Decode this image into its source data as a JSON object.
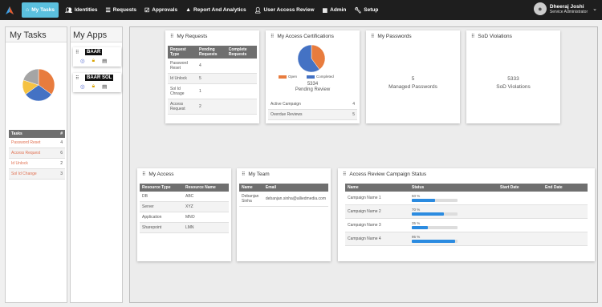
{
  "nav": {
    "items": [
      {
        "label": "My Tasks",
        "icon": "home-icon"
      },
      {
        "label": "Identities",
        "icon": "users-icon"
      },
      {
        "label": "Requests",
        "icon": "list-icon"
      },
      {
        "label": "Approvals",
        "icon": "check-icon"
      },
      {
        "label": "Report And Analytics",
        "icon": "chart-icon"
      },
      {
        "label": "User Access Review",
        "icon": "user-check-icon"
      },
      {
        "label": "Admin",
        "icon": "admin-icon"
      },
      {
        "label": "Setup",
        "icon": "wrench-icon"
      }
    ],
    "user_name": "Dheeraj Joshi",
    "user_role": "Service Administrator"
  },
  "my_tasks": {
    "title": "My Tasks",
    "pie": [
      {
        "value": 35,
        "color": "#e87c3e"
      },
      {
        "value": 30,
        "color": "#4472c4"
      },
      {
        "value": 15,
        "color": "#f5c242"
      },
      {
        "value": 20,
        "color": "#a5a5a5"
      }
    ],
    "table_headers": [
      "Tasks",
      "#"
    ],
    "rows": [
      {
        "name": "Password Reset",
        "count": "4"
      },
      {
        "name": "Access Request",
        "count": "6"
      },
      {
        "name": "Id Unlock",
        "count": "2"
      },
      {
        "name": "Sol Id Change",
        "count": "3"
      }
    ]
  },
  "my_apps": {
    "title": "My Apps",
    "apps": [
      {
        "name": "BAAR"
      },
      {
        "name": "BAAR SOL"
      }
    ]
  },
  "my_requests": {
    "title": "My Requests",
    "headers": [
      "Request Type",
      "Pending Requests",
      "Complete Requests"
    ],
    "rows": [
      {
        "type": "Password Reset",
        "pending": "4",
        "complete": ""
      },
      {
        "type": "Id Unlock",
        "pending": "5",
        "complete": ""
      },
      {
        "type": "Sol Id Chnage",
        "pending": "1",
        "complete": ""
      },
      {
        "type": "Access Request",
        "pending": "2",
        "complete": ""
      }
    ]
  },
  "certifications": {
    "title": "My Access Certifications",
    "legend": [
      "Open",
      "Completed"
    ],
    "legend_colors": [
      "#e87c3e",
      "#4472c4"
    ],
    "pie": [
      {
        "value": 40,
        "color": "#e87c3e"
      },
      {
        "value": 60,
        "color": "#4472c4"
      }
    ],
    "count": "5334",
    "count_label": "Pending Review",
    "rows": [
      {
        "name": "Active Campaign",
        "count": "4"
      },
      {
        "name": "Overdue Reviews",
        "count": "5"
      }
    ]
  },
  "passwords": {
    "title": "My Passwords",
    "count": "5",
    "label": "Managed Passwords"
  },
  "sod": {
    "title": "SoD Violations",
    "count": "5333",
    "label": "SoD Violations"
  },
  "my_access": {
    "title": "My Access",
    "headers": [
      "Resource Type",
      "Resource Name"
    ],
    "rows": [
      {
        "type": "DB",
        "name": "ABC"
      },
      {
        "type": "Server",
        "name": "XYZ"
      },
      {
        "type": "Application",
        "name": "MNO"
      },
      {
        "type": "Sharepoint",
        "name": "LMN"
      }
    ]
  },
  "my_team": {
    "title": "My Team",
    "headers": [
      "Name",
      "Email"
    ],
    "rows": [
      {
        "name": "Debanjan Sinha",
        "email": "debanjan.sinha@alliedmedia.com"
      }
    ]
  },
  "campaign": {
    "title": "Access Review Campaign Status",
    "headers": [
      "Name",
      "Status",
      "Start Date",
      "End Date"
    ],
    "rows": [
      {
        "name": "Campaign Name 1",
        "pct_label": "50 %",
        "progress": 0.5
      },
      {
        "name": "Campaign Name 2",
        "pct_label": "70 %",
        "progress": 0.7
      },
      {
        "name": "Campaign Name 3",
        "pct_label": "35 %",
        "progress": 0.35
      },
      {
        "name": "Campaign Name 4",
        "pct_label": "95 %",
        "progress": 0.95
      }
    ]
  }
}
